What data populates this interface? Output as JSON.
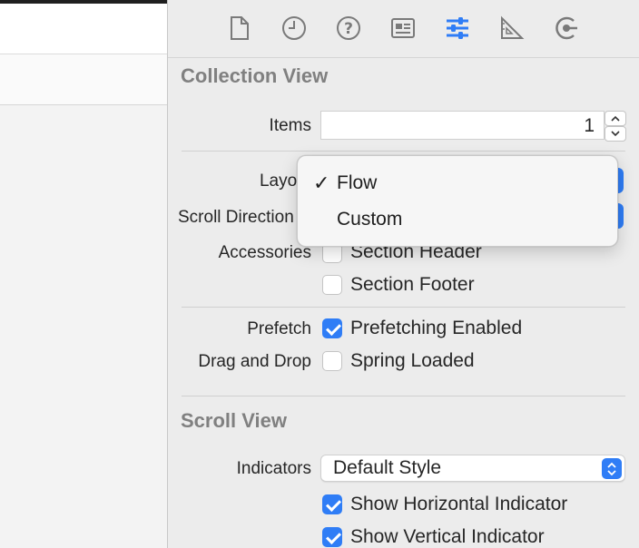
{
  "toolbar": {
    "icons": [
      "file-icon",
      "history-icon",
      "help-icon",
      "identity-icon",
      "attributes-icon",
      "size-icon",
      "connections-icon"
    ],
    "active_icon": "attributes-icon",
    "accent_color": "#2f7df6"
  },
  "collection_view": {
    "title": "Collection View",
    "items_label": "Items",
    "items_value": "1",
    "layout_label": "Layout",
    "scroll_direction_label": "Scroll Direction",
    "accessories_label": "Accessories",
    "section_header_label": "Section Header",
    "section_footer_label": "Section Footer",
    "prefetch_label": "Prefetch",
    "prefetching_enabled_label": "Prefetching Enabled",
    "prefetching_enabled_checked": true,
    "drag_drop_label": "Drag and Drop",
    "spring_loaded_label": "Spring Loaded",
    "spring_loaded_checked": false,
    "section_header_checked": false,
    "section_footer_checked": false
  },
  "layout_menu": {
    "items": [
      {
        "label": "Flow",
        "selected": true,
        "check": "✓"
      },
      {
        "label": "Custom",
        "selected": false,
        "check": ""
      }
    ]
  },
  "scroll_view": {
    "title": "Scroll View",
    "indicators_label": "Indicators",
    "indicators_value": "Default Style",
    "show_horizontal_label": "Show Horizontal Indicator",
    "show_horizontal_checked": true,
    "show_vertical_label": "Show Vertical Indicator",
    "show_vertical_checked": true
  }
}
